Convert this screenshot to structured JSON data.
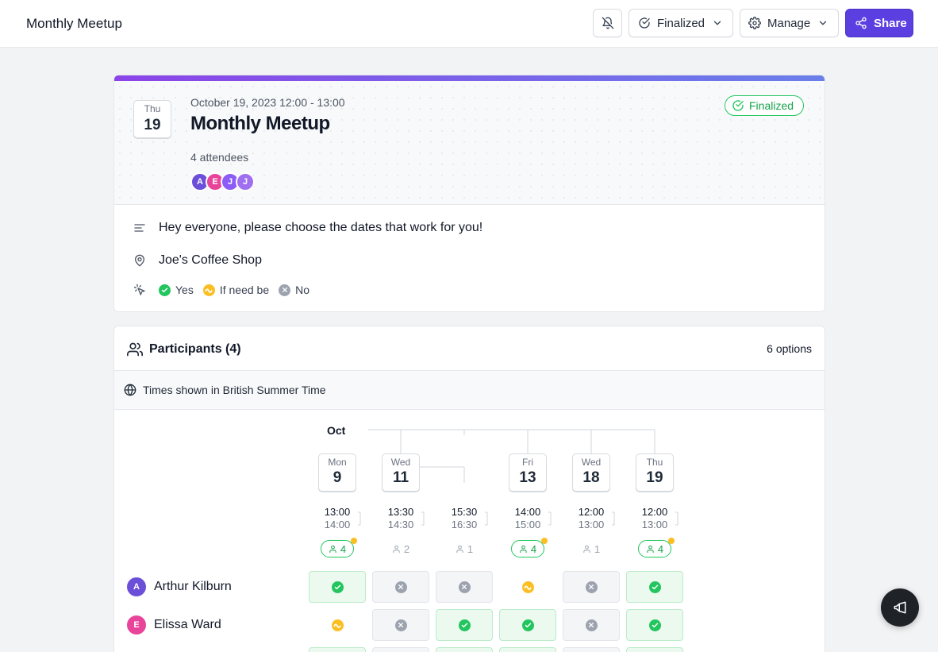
{
  "topbar": {
    "title": "Monthly Meetup",
    "finalized_label": "Finalized",
    "manage_label": "Manage",
    "share_label": "Share"
  },
  "event": {
    "date_dow": "Thu",
    "date_day": "19",
    "when": "October 19, 2023 12:00 - 13:00",
    "title": "Monthly Meetup",
    "attendees_text": "4 attendees",
    "avatars": [
      {
        "initial": "A",
        "color": "#6c4fd8"
      },
      {
        "initial": "E",
        "color": "#e8449a"
      },
      {
        "initial": "J",
        "color": "#8b5cf6"
      },
      {
        "initial": "J",
        "color": "#9f6ff0"
      }
    ],
    "status_label": "Finalized",
    "description": "Hey everyone, please choose the dates that work for you!",
    "location": "Joe's Coffee Shop",
    "legend": {
      "yes": "Yes",
      "ifneedbe": "If need be",
      "no": "No"
    }
  },
  "participants": {
    "title": "Participants (4)",
    "options_text": "6 options",
    "timezone_text": "Times shown in British Summer Time",
    "month": "Oct",
    "options": [
      {
        "dow": "Mon",
        "day": "9",
        "start": "13:00",
        "end": "14:00",
        "count": "4",
        "best": true
      },
      {
        "dow": "Wed",
        "day": "11",
        "start": "13:30",
        "end": "14:30",
        "count": "2",
        "best": false
      },
      {
        "dow": "",
        "day": "",
        "start": "15:30",
        "end": "16:30",
        "count": "1",
        "best": false
      },
      {
        "dow": "Fri",
        "day": "13",
        "start": "14:00",
        "end": "15:00",
        "count": "4",
        "best": true
      },
      {
        "dow": "Wed",
        "day": "18",
        "start": "12:00",
        "end": "13:00",
        "count": "1",
        "best": false
      },
      {
        "dow": "Thu",
        "day": "19",
        "start": "12:00",
        "end": "13:00",
        "count": "4",
        "best": true
      }
    ],
    "people": [
      {
        "initial": "A",
        "name": "Arthur Kilburn",
        "color": "#6c4fd8",
        "votes": [
          "yes",
          "no",
          "no",
          "ifneedbe",
          "no",
          "yes"
        ]
      },
      {
        "initial": "E",
        "name": "Elissa Ward",
        "color": "#e8449a",
        "votes": [
          "ifneedbe",
          "no",
          "yes",
          "yes",
          "no",
          "yes"
        ]
      }
    ],
    "partial_row_votes": [
      "yes",
      "no",
      "yes",
      "yes",
      "no",
      "yes"
    ]
  },
  "colors": {
    "accent": "#5b3fe0",
    "yes": "#22c55e",
    "ifneedbe": "#fbbf24",
    "no": "#9ca3af"
  }
}
